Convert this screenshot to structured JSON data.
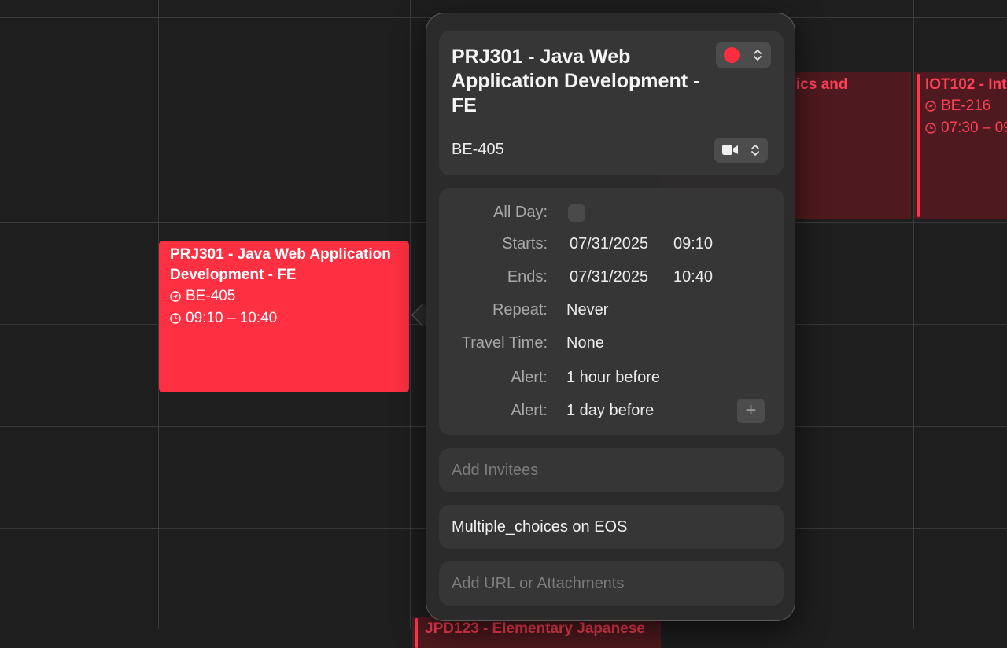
{
  "calendar": {
    "selected_event": {
      "title": "PRJ301 - Java Web Application Development - FE",
      "location": "BE-405",
      "time": "09:10 – 10:40",
      "color": "#fe3042"
    },
    "other_events": [
      {
        "title": "IOT102 - Int",
        "location": "BE-216",
        "time": "07:30 – 09",
        "color": "#ff4057"
      },
      {
        "title": "ics and",
        "color": "#ff4057"
      },
      {
        "title": "JPD123 - Elementary Japanese",
        "color": "#ff4057"
      }
    ]
  },
  "popover": {
    "title": "PRJ301 - Java Web Application Development - FE",
    "calendar_color": "#ff2d3f",
    "location": "BE-405",
    "all_day_label": "All Day:",
    "starts_label": "Starts:",
    "starts_date": "07/31/2025",
    "starts_time": "09:10",
    "ends_label": "Ends:",
    "ends_date": "07/31/2025",
    "ends_time": "10:40",
    "repeat_label": "Repeat:",
    "repeat_value": "Never",
    "travel_label": "Travel Time:",
    "travel_value": "None",
    "alert1_label": "Alert:",
    "alert1_value": "1 hour before",
    "alert2_label": "Alert:",
    "alert2_value": "1 day before",
    "add_alert": "+",
    "invitees_placeholder": "Add Invitees",
    "notes": "Multiple_choices on EOS",
    "url_placeholder": "Add URL or Attachments"
  }
}
